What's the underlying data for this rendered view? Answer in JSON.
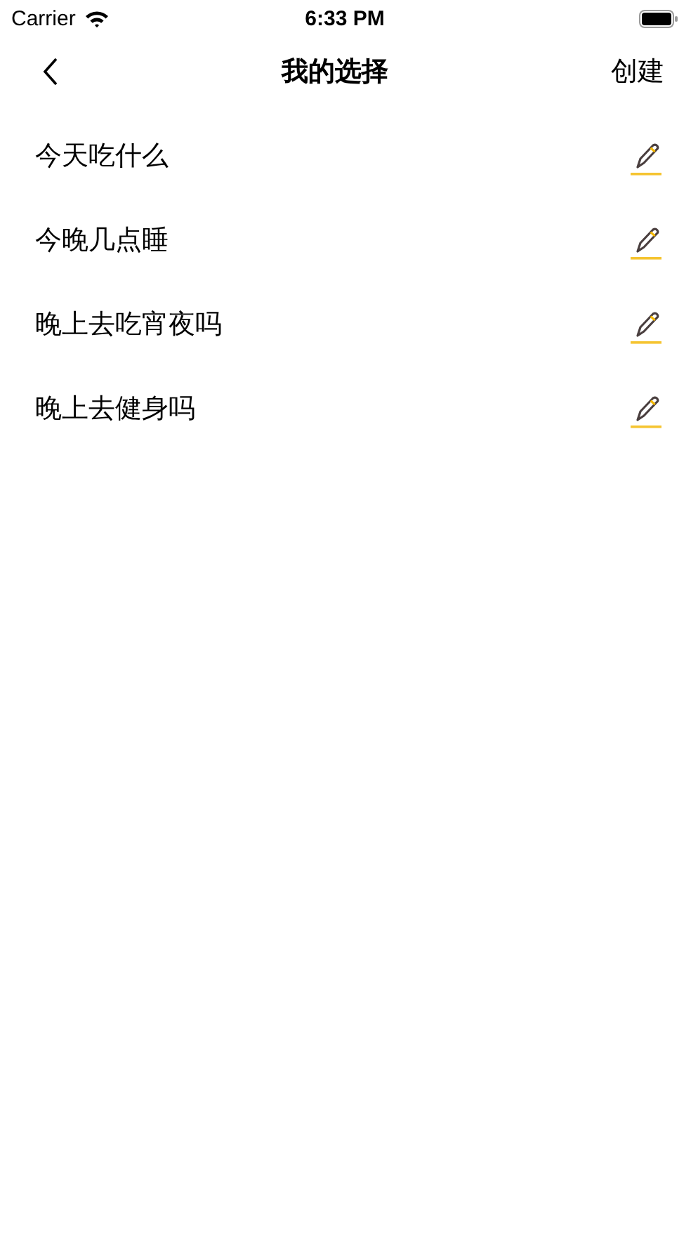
{
  "status_bar": {
    "carrier": "Carrier",
    "time": "6:33 PM"
  },
  "nav": {
    "title": "我的选择",
    "action": "创建"
  },
  "items": [
    {
      "label": "今天吃什么"
    },
    {
      "label": "今晚几点睡"
    },
    {
      "label": "晚上去吃宵夜吗"
    },
    {
      "label": "晚上去健身吗"
    }
  ]
}
